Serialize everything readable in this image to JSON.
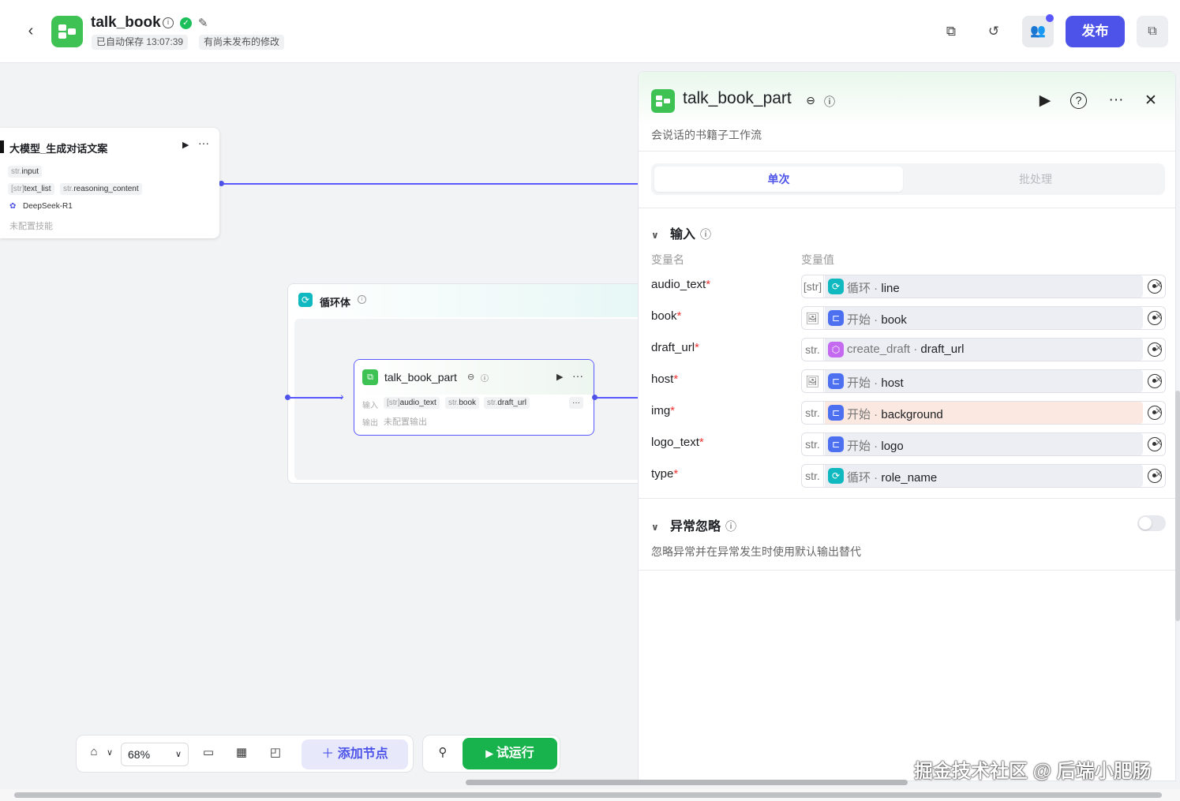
{
  "header": {
    "title": "talk_book",
    "autosave": "已自动保存 13:07:39",
    "unpublished": "有尚未发布的修改",
    "publish_label": "发布"
  },
  "canvas": {
    "llm_node": {
      "title": "大模型_生成对话文案",
      "input_type": "str.",
      "input": "input",
      "out1_type": "[str]",
      "out1": "text_list",
      "out2_type": "str.",
      "out2": "reasoning_content",
      "model": "DeepSeek-R1",
      "skills": "未配置技能"
    },
    "loop_node": {
      "title": "循环体"
    },
    "sub_node": {
      "title": "talk_book_part",
      "in_label": "输入",
      "in1_type": "[str]",
      "in1": "audio_text",
      "in2_type": "str.",
      "in2": "book",
      "in3_type": "str.",
      "in3": "draft_url",
      "more": "···",
      "out_label": "输出",
      "out_value": "未配置输出"
    }
  },
  "panel": {
    "title": "talk_book_part",
    "description": "会说话的书籍子工作流",
    "tabs": [
      "单次",
      "批处理"
    ],
    "input_section": "输入",
    "col_name": "变量名",
    "col_value": "变量值",
    "rows": [
      {
        "name": "audio_text",
        "type": "[str]",
        "icon": "loop-icon",
        "icon_color": "#10b9bf",
        "source": "循环",
        "var": "line",
        "warn": false
      },
      {
        "name": "book",
        "type": "img",
        "icon": "start-icon",
        "icon_color": "#4d70f0",
        "source": "开始",
        "var": "book",
        "warn": false
      },
      {
        "name": "draft_url",
        "type": "str.",
        "icon": "plugin-icon",
        "icon_color": "#c36af0",
        "source": "create_draft",
        "var": "draft_url",
        "warn": false
      },
      {
        "name": "host",
        "type": "img",
        "icon": "start-icon",
        "icon_color": "#4d70f0",
        "source": "开始",
        "var": "host",
        "warn": false
      },
      {
        "name": "img",
        "type": "str.",
        "icon": "start-icon",
        "icon_color": "#4d70f0",
        "source": "开始",
        "var": "background",
        "warn": true
      },
      {
        "name": "logo_text",
        "type": "str.",
        "icon": "start-icon",
        "icon_color": "#4d70f0",
        "source": "开始",
        "var": "logo",
        "warn": false
      },
      {
        "name": "type",
        "type": "str.",
        "icon": "loop-icon",
        "icon_color": "#10b9bf",
        "source": "循环",
        "var": "role_name",
        "warn": false
      }
    ],
    "ignore_section": "异常忽略",
    "ignore_desc": "忽略异常并在异常发生时使用默认输出替代",
    "ignore_enabled": false
  },
  "toolbar": {
    "zoom": "68%",
    "add_node": "添加节点",
    "run": "试运行"
  },
  "watermark": "掘金技术社区 @ 后端小肥肠",
  "colors": {
    "accent": "#4d53e8",
    "run": "#18b34c",
    "logo": "#3ec254"
  }
}
